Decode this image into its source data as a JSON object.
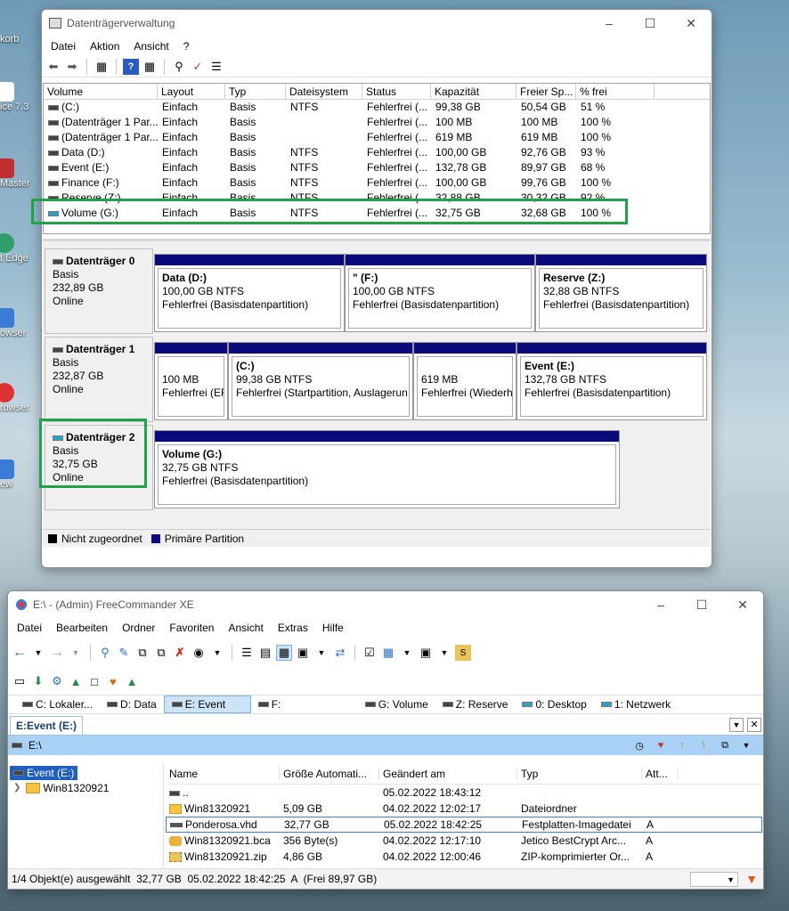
{
  "desktop": {
    "icons": [
      "korb",
      "ice 7.3",
      "Master",
      "t Edge",
      "owser",
      "rowser",
      "ew"
    ]
  },
  "diskmgmt": {
    "title": "Datenträgerverwaltung",
    "menu": [
      "Datei",
      "Aktion",
      "Ansicht",
      "?"
    ],
    "columns": [
      "Volume",
      "Layout",
      "Typ",
      "Dateisystem",
      "Status",
      "Kapazität",
      "Freier Sp...",
      "% frei"
    ],
    "rows": [
      [
        "(C:)",
        "Einfach",
        "Basis",
        "NTFS",
        "Fehlerfrei (...",
        "99,38 GB",
        "50,54 GB",
        "51 %"
      ],
      [
        "(Datenträger 1 Par...",
        "Einfach",
        "Basis",
        "",
        "Fehlerfrei (...",
        "100 MB",
        "100 MB",
        "100 %"
      ],
      [
        "(Datenträger 1 Par...",
        "Einfach",
        "Basis",
        "",
        "Fehlerfrei (...",
        "619 MB",
        "619 MB",
        "100 %"
      ],
      [
        "Data (D:)",
        "Einfach",
        "Basis",
        "NTFS",
        "Fehlerfrei (...",
        "100,00 GB",
        "92,76 GB",
        "93 %"
      ],
      [
        "Event (E:)",
        "Einfach",
        "Basis",
        "NTFS",
        "Fehlerfrei (...",
        "132,78 GB",
        "89,97 GB",
        "68 %"
      ],
      [
        "Finance (F:)",
        "Einfach",
        "Basis",
        "NTFS",
        "Fehlerfrei (...",
        "100,00 GB",
        "99,76 GB",
        "100 %"
      ],
      [
        "Reserve (Z:)",
        "Einfach",
        "Basis",
        "NTFS",
        "Fehlerfrei (...",
        "32,88 GB",
        "30,32 GB",
        "92 %"
      ],
      [
        "Volume (G:)",
        "Einfach",
        "Basis",
        "NTFS",
        "Fehlerfrei (...",
        "32,75 GB",
        "32,68 GB",
        "100 %"
      ]
    ],
    "disks": [
      {
        "name": "Datenträger 0",
        "type": "Basis",
        "size": "232,89 GB",
        "state": "Online",
        "parts": [
          {
            "label": "Data  (D:)",
            "size": "100,00 GB NTFS",
            "status": "Fehlerfrei (Basisdatenpartition)"
          },
          {
            "label": "\"            (F:)",
            "size": "100,00 GB NTFS",
            "status": "Fehlerfrei (Basisdatenpartition)"
          },
          {
            "label": "Reserve  (Z:)",
            "size": "32,88 GB NTFS",
            "status": "Fehlerfrei (Basisdatenpartition)"
          }
        ]
      },
      {
        "name": "Datenträger 1",
        "type": "Basis",
        "size": "232,87 GB",
        "state": "Online",
        "parts": [
          {
            "label": "",
            "size": "100 MB",
            "status": "Fehlerfrei (EF"
          },
          {
            "label": "(C:)",
            "size": "99,38 GB NTFS",
            "status": "Fehlerfrei (Startpartition, Auslagerun"
          },
          {
            "label": "",
            "size": "619 MB",
            "status": "Fehlerfrei (Wiederh"
          },
          {
            "label": "Event  (E:)",
            "size": "132,78 GB NTFS",
            "status": "Fehlerfrei (Basisdatenpartition)"
          }
        ]
      },
      {
        "name": "Datenträger 2",
        "type": "Basis",
        "size": "32,75 GB",
        "state": "Online",
        "parts": [
          {
            "label": "Volume  (G:)",
            "size": "32,75 GB NTFS",
            "status": "Fehlerfrei (Basisdatenpartition)"
          }
        ]
      }
    ],
    "legend": [
      "Nicht zugeordnet",
      "Primäre Partition"
    ],
    "colors": {
      "unallocated": "#000000",
      "primary": "#0a0a7a",
      "highlight": "#20a348"
    }
  },
  "fc": {
    "title": "E:\\ - (Admin) FreeCommander XE",
    "menu": [
      "Datei",
      "Bearbeiten",
      "Ordner",
      "Favoriten",
      "Ansicht",
      "Extras",
      "Hilfe"
    ],
    "drive_tabs": [
      "C: Lokaler...",
      "D: Data",
      "E: Event",
      "F:",
      "G: Volume",
      "Z: Reserve",
      "0: Desktop",
      "1: Netzwerk"
    ],
    "panel_tab": "E:Event (E:)",
    "path": "E:\\",
    "tree": [
      "Event (E:)",
      "Win81320921"
    ],
    "columns": [
      "Name",
      "Größe Automati...",
      "Geändert am",
      "Typ",
      "Att..."
    ],
    "files": [
      {
        "name": "..",
        "size": "",
        "date": "05.02.2022 18:43:12",
        "type": "",
        "attr": ""
      },
      {
        "name": "Win81320921",
        "size": "5,09 GB",
        "date": "04.02.2022 12:02:17",
        "type": "Dateiordner",
        "attr": ""
      },
      {
        "name": "Ponderosa.vhd",
        "size": "32,77 GB",
        "date": "05.02.2022 18:42:25",
        "type": "Festplatten-Imagedatei",
        "attr": "A"
      },
      {
        "name": "Win81320921.bca",
        "size": "356 Byte(s)",
        "date": "04.02.2022 12:17:10",
        "type": "Jetico BestCrypt Arc...",
        "attr": "A"
      },
      {
        "name": "Win81320921.zip",
        "size": "4,86 GB",
        "date": "04.02.2022 12:00:46",
        "type": "ZIP-komprimierter Or...",
        "attr": "A"
      }
    ],
    "status": "1/4 Objekt(e) ausgewählt  32,77 GB  05.02.2022 18:42:25  A  (Frei 89,97 GB)"
  }
}
